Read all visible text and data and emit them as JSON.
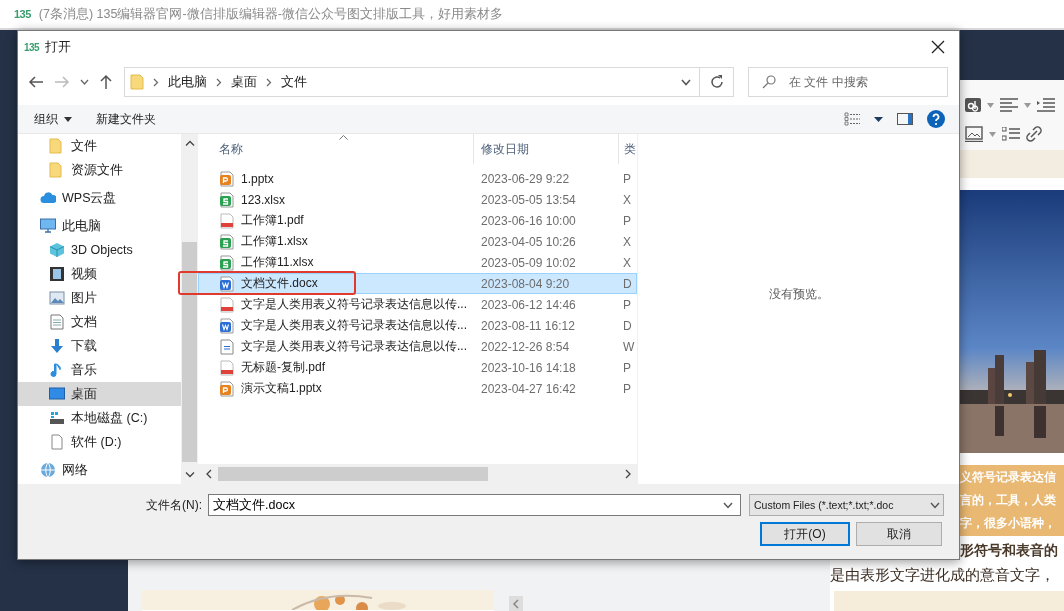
{
  "browser_tab": {
    "logo": "135",
    "title": "(7条消息) 135编辑器官网-微信排版编辑器-微信公众号图文排版工具，好用素材多"
  },
  "dialog": {
    "logo": "135",
    "title": "打开",
    "address": {
      "path": [
        "此电脑",
        "桌面",
        "文件"
      ]
    },
    "search": {
      "placeholder": "在 文件 中搜索"
    },
    "toolbar": {
      "organize": "组织",
      "new_folder": "新建文件夹"
    },
    "nav": {
      "items": [
        {
          "children": [
            {
              "label": "文件",
              "kind": "folder",
              "selected": false
            },
            {
              "label": "资源文件",
              "kind": "folder",
              "selected": false
            }
          ]
        },
        {
          "label": "WPS云盘",
          "kind": "cloud",
          "selected": false
        },
        {
          "label": "此电脑",
          "kind": "pc",
          "selected": false,
          "children": [
            {
              "label": "3D Objects",
              "kind": "objects",
              "selected": false
            },
            {
              "label": "视频",
              "kind": "video",
              "selected": false
            },
            {
              "label": "图片",
              "kind": "pictures",
              "selected": false
            },
            {
              "label": "文档",
              "kind": "docs",
              "selected": false
            },
            {
              "label": "下载",
              "kind": "download",
              "selected": false
            },
            {
              "label": "音乐",
              "kind": "music",
              "selected": false
            },
            {
              "label": "桌面",
              "kind": "desktop",
              "selected": true
            },
            {
              "label": "本地磁盘 (C:)",
              "kind": "drive",
              "selected": false
            },
            {
              "label": "软件 (D:)",
              "kind": "disk",
              "selected": false
            }
          ]
        },
        {
          "label": "网络",
          "kind": "network",
          "selected": false
        }
      ]
    },
    "files": {
      "columns": [
        "名称",
        "修改日期",
        "类"
      ],
      "rows": [
        {
          "name": "1.pptx",
          "date": "2023-06-29 9:22",
          "column_3": "P",
          "kind": "pptx",
          "selected": false,
          "highlighted": false
        },
        {
          "name": "123.xlsx",
          "date": "2023-05-05 13:54",
          "column_3": "X",
          "kind": "xlsx",
          "selected": false,
          "highlighted": false
        },
        {
          "name": "工作簿1.pdf",
          "date": "2023-06-16 10:00",
          "column_3": "P",
          "kind": "pdf",
          "selected": false,
          "highlighted": false
        },
        {
          "name": "工作簿1.xlsx",
          "date": "2023-04-05 10:26",
          "column_3": "X",
          "kind": "xlsx",
          "selected": false,
          "highlighted": false
        },
        {
          "name": "工作簿11.xlsx",
          "date": "2023-05-09 10:02",
          "column_3": "X",
          "kind": "xlsx",
          "selected": false,
          "highlighted": false
        },
        {
          "name": "文档文件.docx",
          "date": "2023-08-04 9:20",
          "column_3": "D",
          "kind": "docx",
          "selected": true,
          "highlighted": true
        },
        {
          "name": "文字是人类用表义符号记录表达信息以传...",
          "date": "2023-06-12 14:46",
          "column_3": "P",
          "kind": "pdf",
          "selected": false,
          "highlighted": false
        },
        {
          "name": "文字是人类用表义符号记录表达信息以传...",
          "date": "2023-08-11 16:12",
          "column_3": "D",
          "kind": "docx",
          "selected": false,
          "highlighted": false
        },
        {
          "name": "文字是人类用表义符号记录表达信息以传...",
          "date": "2022-12-26 8:54",
          "column_3": "W",
          "kind": "txt",
          "selected": false,
          "highlighted": false
        },
        {
          "name": "无标题-复制.pdf",
          "date": "2023-10-16 14:18",
          "column_3": "P",
          "kind": "pdf",
          "selected": false,
          "highlighted": false
        },
        {
          "name": "演示文稿1.pptx",
          "date": "2023-04-27 16:42",
          "column_3": "P",
          "kind": "pptx",
          "selected": false,
          "highlighted": false
        }
      ]
    },
    "preview": {
      "message": "没有预览。"
    },
    "filename": {
      "label": "文件名(N):",
      "value": "文档文件.docx"
    },
    "filter": {
      "value": "Custom Files (*.text;*.txt;*.doc"
    },
    "buttons": [
      {
        "label": "打开(O)",
        "kind": "primary"
      },
      {
        "label": "取消",
        "kind": "normal"
      }
    ]
  },
  "editor": {
    "lines": [
      {
        "text": "义符号记录表达信",
        "kind": "band"
      },
      {
        "text": "言的，工具，人类",
        "kind": "band"
      },
      {
        "text": "字，很多小语种，",
        "kind": "band"
      },
      {
        "text": "形符号和表音的",
        "kind": "heading"
      }
    ],
    "bottom_line": "是由表形文字进化成的意音文字，"
  }
}
